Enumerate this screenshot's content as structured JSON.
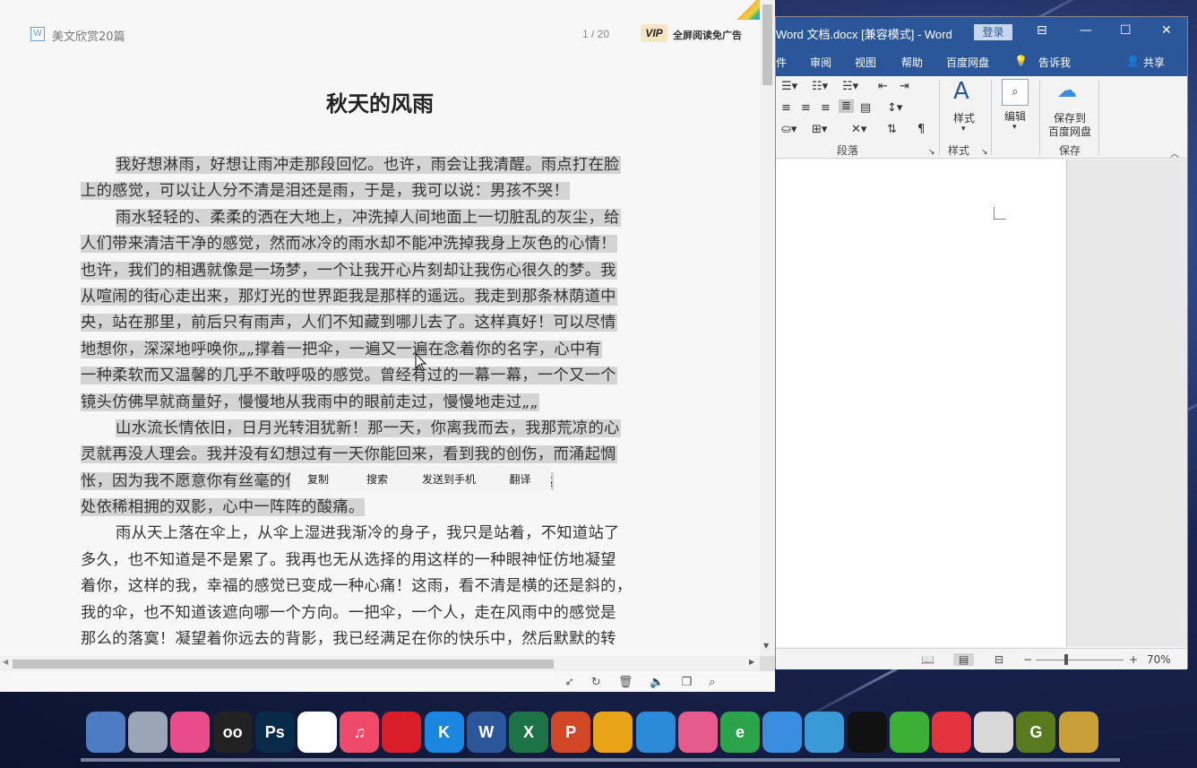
{
  "reader": {
    "doc_name": "美文欣赏20篇",
    "page_indicator": "1  / 20",
    "vip_badge": "VIP",
    "vip_text": "全屏阅读免广告",
    "title": "秋天的风雨",
    "lines": [
      "我好想淋雨，好想让雨冲走那段回忆。也许，雨会让我清醒。雨点打在脸",
      "上的感觉，可以让人分不清是泪还是雨，于是，我可以说：男孩不哭！",
      "雨水轻轻的、柔柔的洒在大地上，冲洗掉人间地面上一切脏乱的灰尘，给",
      "人们带来清洁干净的感觉，然而冰冷的雨水却不能冲洗掉我身上灰色的心情！",
      "也许，我们的相遇就像是一场梦，一个让我开心片刻却让我伤心很久的梦。我",
      "从喧闹的街心走出来，那灯光的世界距我是那样的遥远。我走到那条林荫道中",
      "央，站在那里，前后只有雨声，人们不知藏到哪儿去了。这样真好！可以尽情",
      "地想你，深深地呼唤你„„撑着一把伞，一遍又一遍在念着你的名字，心中有",
      "一种柔软而又温馨的几乎不敢呼吸的感觉。曾经有过的一幕一幕，一个又一个",
      "镜头仿佛早就商量好，慢慢地从我雨中的眼前走过，慢慢地走过„„",
      "山水流长情依旧，日月光转泪犹新！那一天，你离我而去，我那荒凉的心",
      "灵就再没人理会。我并没有幻想过有一天你能回来，看到我的创伤，而涌起惆",
      "怅，因为我不愿意你有丝毫的伤感。我独自走在林荫道上，看着不远",
      "处依稀相拥的双影，心中一阵阵的酸痛。",
      "雨从天上落在伞上，从伞上湿进我渐冷的身子，我只是站着，不知道站了",
      "多久，也不知道是不是累了。我再也无从选择的用这样的一种眼神怔仿地凝望",
      "着你，这样的我，幸福的感觉已变成一种心痛！这雨，看不清是横的还是斜的，",
      "我的伞，也不知道该遮向哪一个方向。一把伞，一个人，走在风雨中的感觉是",
      "那么的落寞！凝望着你远去的背影，我已经满足在你的快乐中，然后默默的转"
    ],
    "context_menu": [
      "复制",
      "搜索",
      "发送到手机",
      "翻译"
    ]
  },
  "word": {
    "title": "Word 文档.docx [兼容模式]  -  Word",
    "login": "登录",
    "menu": [
      "件",
      "审阅",
      "视图",
      "帮助",
      "百度网盘",
      "告诉我",
      "共享"
    ],
    "ribbon": {
      "styles_label": "样式",
      "edit_label": "编辑",
      "save_to_baidu": "保存到",
      "save_to_baidu_2": "百度网盘",
      "group_paragraph": "段落",
      "group_styles": "样式",
      "group_save": "保存"
    },
    "zoom": "70%"
  },
  "taskbar": {
    "apps": [
      {
        "name": "computer-icon",
        "label": "",
        "color": "#4d7bc4"
      },
      {
        "name": "recycle-bin-icon",
        "label": "",
        "color": "#9aa5b5"
      },
      {
        "name": "app-colorful-icon",
        "label": "",
        "color": "#e84d8a"
      },
      {
        "name": "oo-app-icon",
        "label": "oo",
        "color": "#222222"
      },
      {
        "name": "photoshop-icon",
        "label": "Ps",
        "color": "#0a2a4a"
      },
      {
        "name": "baidu-netdisk-icon",
        "label": "",
        "color": "#ffffff"
      },
      {
        "name": "music-icon",
        "label": "♫",
        "color": "#f04a6a"
      },
      {
        "name": "netease-music-icon",
        "label": "",
        "color": "#d91e2a"
      },
      {
        "name": "kugou-icon",
        "label": "K",
        "color": "#1a86e0"
      },
      {
        "name": "word-icon",
        "label": "W",
        "color": "#2b579a"
      },
      {
        "name": "excel-icon",
        "label": "X",
        "color": "#1d7345"
      },
      {
        "name": "powerpoint-icon",
        "label": "P",
        "color": "#d24726"
      },
      {
        "name": "chrome-icon",
        "label": "",
        "color": "#e8a317"
      },
      {
        "name": "cloud-app-icon",
        "label": "",
        "color": "#2c8ad8"
      },
      {
        "name": "colorful-ball-icon",
        "label": "",
        "color": "#e45b8c"
      },
      {
        "name": "ie-icon",
        "label": "e",
        "color": "#2aa34a"
      },
      {
        "name": "paper-plane-icon",
        "label": "",
        "color": "#3a8ee0"
      },
      {
        "name": "chat-bubbles-icon",
        "label": "",
        "color": "#3a9ad8"
      },
      {
        "name": "qq-icon",
        "label": "",
        "color": "#111111"
      },
      {
        "name": "wechat-icon",
        "label": "",
        "color": "#3cb034"
      },
      {
        "name": "xmind-icon",
        "label": "",
        "color": "#e3343d"
      },
      {
        "name": "screen-recorder-icon",
        "label": "",
        "color": "#d8d8d8"
      },
      {
        "name": "g-app-icon",
        "label": "G",
        "color": "#5a7a20"
      },
      {
        "name": "tools-icon",
        "label": "",
        "color": "#c9a038"
      }
    ]
  }
}
